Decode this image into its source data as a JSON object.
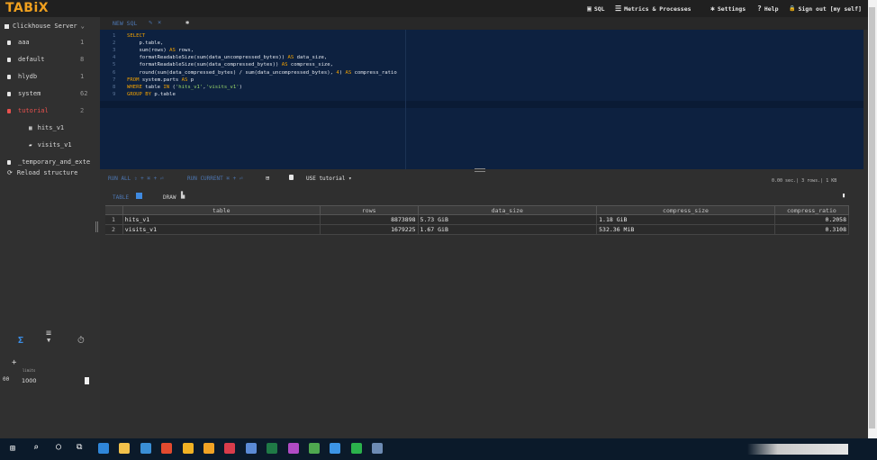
{
  "app": {
    "logo": "TABiX",
    "nav": [
      {
        "icon": "sql-icon",
        "glyph": "▣",
        "label": "SQL"
      },
      {
        "icon": "metrics-icon",
        "glyph": "☰",
        "label": "Metrics & Processes"
      },
      {
        "icon": "gear-icon",
        "glyph": "✱",
        "label": "Settings"
      },
      {
        "icon": "help-icon",
        "glyph": "?",
        "label": "Help"
      },
      {
        "icon": "lock-icon",
        "glyph": "🔒",
        "label": "Sign out [my self]"
      }
    ]
  },
  "sidebar": {
    "server_label": "Clickhouse Server",
    "server_chevron": "⌄",
    "databases": [
      {
        "name": "aaa",
        "count": "1"
      },
      {
        "name": "default",
        "count": "8"
      },
      {
        "name": "hlydb",
        "count": "1"
      },
      {
        "name": "system",
        "count": "62"
      },
      {
        "name": "tutorial",
        "count": "2",
        "active": true
      }
    ],
    "tables": [
      {
        "name": "hits_v1",
        "icon": "▦"
      },
      {
        "name": "visits_v1",
        "icon": "▰"
      }
    ],
    "extra_db": {
      "name": "_temporary_and_exte"
    },
    "reload": {
      "icon": "⟳",
      "label": "Reload structure"
    },
    "tools": {
      "sigma": "Σ",
      "list": "≡",
      "history": "⏱"
    },
    "limits": {
      "plus": "+",
      "label": "limits",
      "prefix": "00",
      "value": "1000"
    }
  },
  "editor": {
    "tab_label": "NEW SQL",
    "tab_pencil": "✎",
    "tab_close": "×",
    "tab_gear": "✱",
    "lines": [
      {
        "n": "1",
        "parts": [
          {
            "t": "kw",
            "v": "SELECT"
          }
        ]
      },
      {
        "n": "2",
        "parts": [
          {
            "t": "tx",
            "v": "    p.table,"
          }
        ]
      },
      {
        "n": "3",
        "parts": [
          {
            "t": "tx",
            "v": "    sum(rows) "
          },
          {
            "t": "kw",
            "v": "AS"
          },
          {
            "t": "tx",
            "v": " rows,"
          }
        ]
      },
      {
        "n": "4",
        "parts": [
          {
            "t": "tx",
            "v": "    formatReadableSize(sum(data_uncompressed_bytes)) "
          },
          {
            "t": "kw",
            "v": "AS"
          },
          {
            "t": "tx",
            "v": " data_size,"
          }
        ]
      },
      {
        "n": "5",
        "parts": [
          {
            "t": "tx",
            "v": "    formatReadableSize(sum(data_compressed_bytes)) "
          },
          {
            "t": "kw",
            "v": "AS"
          },
          {
            "t": "tx",
            "v": " compress_size,"
          }
        ]
      },
      {
        "n": "6",
        "parts": [
          {
            "t": "tx",
            "v": "    round(sum(data_compressed_bytes) / sum(data_uncompressed_bytes), "
          },
          {
            "t": "kw",
            "v": "4"
          },
          {
            "t": "tx",
            "v": ") "
          },
          {
            "t": "kw",
            "v": "AS"
          },
          {
            "t": "tx",
            "v": " compress_ratio"
          }
        ]
      },
      {
        "n": "7",
        "parts": [
          {
            "t": "kw",
            "v": "FROM"
          },
          {
            "t": "tx",
            "v": " system.parts "
          },
          {
            "t": "kw",
            "v": "AS"
          },
          {
            "t": "tx",
            "v": " p"
          }
        ]
      },
      {
        "n": "8",
        "parts": [
          {
            "t": "kw",
            "v": "WHERE"
          },
          {
            "t": "tx",
            "v": " table "
          },
          {
            "t": "kw",
            "v": "IN"
          },
          {
            "t": "tx",
            "v": " ("
          },
          {
            "t": "st",
            "v": "'hits_v1'"
          },
          {
            "t": "tx",
            "v": ","
          },
          {
            "t": "st",
            "v": "'visits_v1'"
          },
          {
            "t": "tx",
            "v": ")"
          }
        ]
      },
      {
        "n": "9",
        "parts": [
          {
            "t": "kw",
            "v": "GROUP BY"
          },
          {
            "t": "tx",
            "v": " p.table"
          }
        ]
      }
    ]
  },
  "runbar": {
    "run_all": "RUN ALL ⇧ + ⌘ + ⏎",
    "run_current": "RUN CURRENT ⌘ + ⏎",
    "stop": "⊞",
    "use_db": "USE tutorial  ▾",
    "stats": "0.00 sec.| 3 rows.| 1 KB"
  },
  "results": {
    "tab_table": "TABLE",
    "tab_draw": "DRAW",
    "draw_icon": "▙",
    "pin_icon": "📌",
    "columns": [
      "table",
      "rows",
      "data_size",
      "compress_size",
      "compress_ratio"
    ],
    "rows": [
      {
        "n": "1",
        "table": "hits_v1",
        "rows": "8873898",
        "data_size": "5.73 GiB",
        "compress_size": "1.18 GiB",
        "compress_ratio": "0.2058"
      },
      {
        "n": "2",
        "table": "visits_v1",
        "rows": "1679225",
        "data_size": "1.67 GiB",
        "compress_size": "532.36 MiB",
        "compress_ratio": "0.3108"
      }
    ]
  },
  "taskbar": {
    "start": "⊞",
    "search": "⌕",
    "cortana": "○",
    "taskview": "⧉",
    "apps": [
      {
        "name": "edge-icon",
        "color": "#2f86d9"
      },
      {
        "name": "explorer-icon",
        "color": "#f2c14b"
      },
      {
        "name": "app3-icon",
        "color": "#3a8fd6"
      },
      {
        "name": "app4-icon",
        "color": "#e24a2f"
      },
      {
        "name": "chrome-icon",
        "color": "#f0b224"
      },
      {
        "name": "app6-icon",
        "color": "#f0a325"
      },
      {
        "name": "app7-icon",
        "color": "#d93c4b"
      },
      {
        "name": "app8-icon",
        "color": "#5b8bd6"
      },
      {
        "name": "excel-icon",
        "color": "#1f7a46"
      },
      {
        "name": "app10-icon",
        "color": "#b04bc4"
      },
      {
        "name": "app11-icon",
        "color": "#4fa84f"
      },
      {
        "name": "app12-icon",
        "color": "#3c95e6"
      },
      {
        "name": "wechat-icon",
        "color": "#2bb24c"
      },
      {
        "name": "app14-icon",
        "color": "#6d8bb3"
      }
    ]
  }
}
